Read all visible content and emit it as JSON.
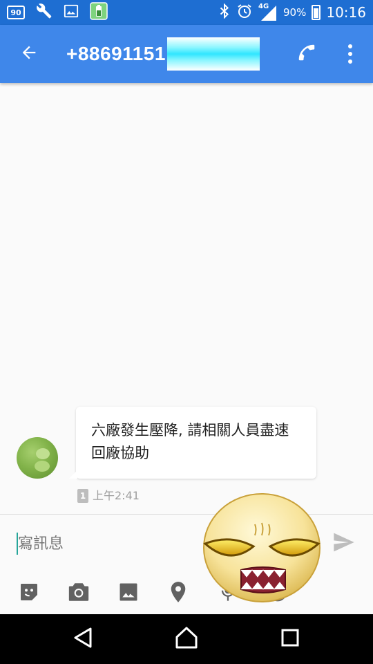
{
  "status_bar": {
    "left_icons": [
      "ninety-box-icon",
      "wrench-icon",
      "image-icon",
      "android-battery-icon"
    ],
    "ninety_label": "90",
    "right_icons": [
      "bluetooth-icon",
      "alarm-icon",
      "signal-4g-icon",
      "battery-icon"
    ],
    "network_label": "4G",
    "battery_percent": "90%",
    "time": "10:16"
  },
  "app_bar": {
    "title": "+88691151",
    "title_redacted": true,
    "back_icon": "back-arrow-icon",
    "call_icon": "phone-icon",
    "menu_icon": "more-vertical-icon"
  },
  "conversation": {
    "messages": [
      {
        "direction": "incoming",
        "text": "六廠發生壓降, 請相關人員盡速回廠協助",
        "sim_slot": "1",
        "time": "上午2:41"
      }
    ]
  },
  "compose": {
    "placeholder": "寫訊息",
    "send_icon": "send-icon",
    "tools": [
      "sticker-icon",
      "camera-icon",
      "gallery-icon",
      "location-icon",
      "microphone-icon",
      "more-icon"
    ]
  },
  "overlay": {
    "sticker": "annoyed-face-sticker"
  },
  "nav_bar": {
    "buttons": [
      "back-triangle-icon",
      "home-icon",
      "recents-icon"
    ]
  },
  "colors": {
    "status_bar": "#1e6ed2",
    "app_bar": "#3f87ea",
    "background": "#fafafa",
    "accent": "#26a69a"
  }
}
